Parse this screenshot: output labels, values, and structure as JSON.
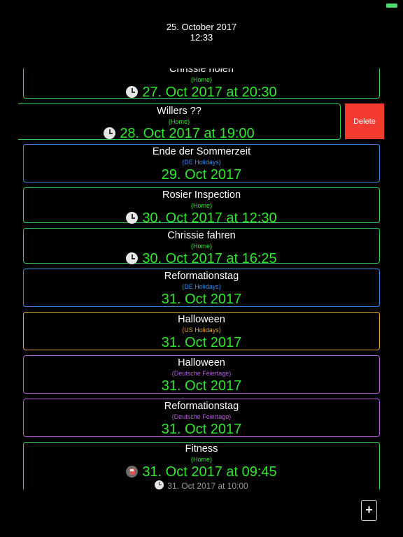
{
  "header": {
    "date": "25. October 2017",
    "time": "12:33"
  },
  "colors": {
    "home": "#34c759",
    "de_holidays": "#3a86d8",
    "us_holidays": "#e0a53a",
    "deutsche_feiertage": "#b25bd6",
    "delete": "#f23a30",
    "date_text": "#2ee82e"
  },
  "events": [
    {
      "title": "Chrissie holen",
      "calendar": "(Home)",
      "when": "27. Oct 2017 at 20:30",
      "icon": "clock-icon"
    },
    {
      "title": "Willers ??",
      "calendar": "(Home)",
      "when": "28. Oct 2017 at 19:00",
      "icon": "clock-icon",
      "swiped": true
    },
    {
      "title": "Ende der Sommerzeit",
      "calendar": "(DE Holidays)",
      "when": "29. Oct 2017"
    },
    {
      "title": "Rosier Inspection",
      "calendar": "(Home)",
      "when": "30. Oct 2017 at 12:30",
      "icon": "clock-icon"
    },
    {
      "title": "Chrissie fahren",
      "calendar": "(Home)",
      "when": "30. Oct 2017 at 16:25",
      "icon": "clock-icon"
    },
    {
      "title": "Reformationstag",
      "calendar": "(DE Holidays)",
      "when": "31. Oct 2017"
    },
    {
      "title": "Halloween",
      "calendar": "(US Holidays)",
      "when": "31. Oct 2017"
    },
    {
      "title": "Halloween",
      "calendar": "(Deutsche Feiertage)",
      "when": "31. Oct 2017"
    },
    {
      "title": "Reformationstag",
      "calendar": "(Deutsche Feiertage)",
      "when": "31. Oct 2017"
    },
    {
      "title": "Fitness",
      "calendar": "(Home)",
      "when": "31. Oct 2017 at 09:45",
      "icon": "train-icon",
      "when2": "31. Oct 2017 at 10:00",
      "icon2": "clock-icon"
    }
  ],
  "actions": {
    "delete_label": "Delete",
    "add_label": "+"
  }
}
